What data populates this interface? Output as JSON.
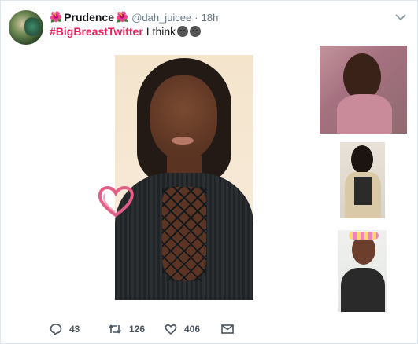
{
  "tweet": {
    "display_name": "Prudence",
    "name_emoji": "🌺",
    "handle": "@dah_juicee",
    "separator": "·",
    "time": "18h",
    "hashtag": "#BigBreastTwitter",
    "text": "I think"
  },
  "actions": {
    "reply_count": "43",
    "retweet_count": "126",
    "like_count": "406"
  },
  "icons": [
    "avatar",
    "flower-icon",
    "chevron-down-icon",
    "reply-icon",
    "retweet-icon",
    "like-icon",
    "message-icon",
    "heart-sticker-icon"
  ],
  "colors": {
    "hashtag": "#e0245e",
    "muted": "#657786",
    "text": "#14171a"
  }
}
